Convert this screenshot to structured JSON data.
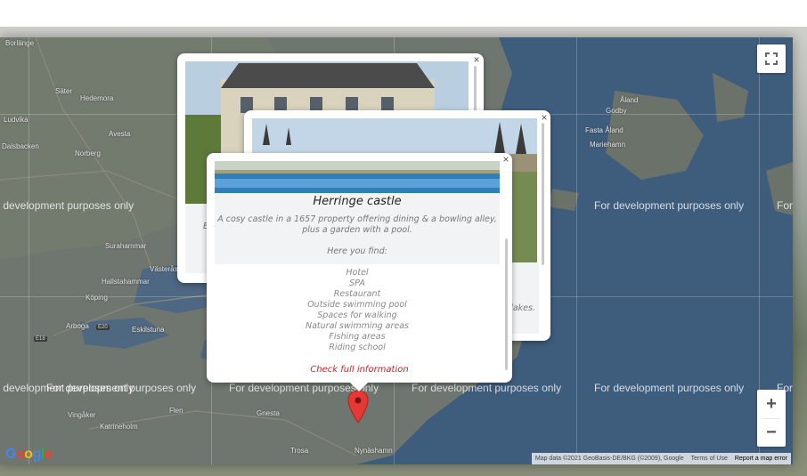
{
  "map": {
    "dev_watermark": "For development purposes only",
    "places": [
      {
        "name": "Borlänge"
      },
      {
        "name": "Säter"
      },
      {
        "name": "Hedemora"
      },
      {
        "name": "Avesta"
      },
      {
        "name": "Ludvika"
      },
      {
        "name": "Norberg"
      },
      {
        "name": "Surahammar"
      },
      {
        "name": "Västerås"
      },
      {
        "name": "Hallstahammar"
      },
      {
        "name": "Köping"
      },
      {
        "name": "Arboga"
      },
      {
        "name": "Eskilstuna"
      },
      {
        "name": "Flen"
      },
      {
        "name": "Vingåker"
      },
      {
        "name": "Katrineholm"
      },
      {
        "name": "Gnesta"
      },
      {
        "name": "Trosa"
      },
      {
        "name": "Nynäshamn"
      },
      {
        "name": "Åland"
      },
      {
        "name": "Godby"
      },
      {
        "name": "Fasta Åland"
      },
      {
        "name": "Mariehamn"
      },
      {
        "name": "Dalsbacken"
      }
    ],
    "attribution": "Map data ©2021 GeoBasis-DE/BKG (©2009), Google",
    "terms": "Terms of Use",
    "report": "Report a map error",
    "google_letters": [
      "G",
      "o",
      "o",
      "g",
      "l",
      "e"
    ]
  },
  "controls": {
    "fullscreen_icon": "fullscreen-icon",
    "zoom_in": "+",
    "zoom_out": "−"
  },
  "popups": {
    "close_glyph": "×",
    "front": {
      "title": "Herringe castle",
      "description": "A cosy castle in a 1657 property offering dining & a bowling alley, plus a garden with a pool.",
      "find_label": "Here you find:",
      "features": [
        "Hotel",
        "SPA",
        "Restaurant",
        "Outside swimming pool",
        "Spaces for walking",
        "Natural swimming areas",
        "Fishing areas",
        "Riding school"
      ],
      "link": "Check full information"
    },
    "middle": {
      "fragment": "lakes."
    },
    "back": {
      "fragment": "E"
    }
  },
  "colors": {
    "water": "#3e5d7d",
    "land": "#6e7670",
    "accent_link": "#c0262d",
    "marker": "#e53935"
  }
}
